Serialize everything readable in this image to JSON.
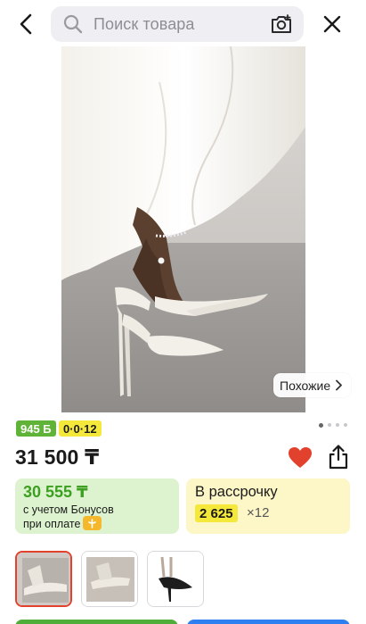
{
  "header": {
    "search_placeholder": "Поиск товара"
  },
  "gallery": {
    "similar_label": "Похожие",
    "pages": 4,
    "current_page": 1
  },
  "badges": {
    "rating": "945 Б",
    "installment": "0·0·12"
  },
  "product": {
    "price": "31 500 ₸",
    "favorite": true
  },
  "bonus": {
    "amount": "30 555 ₸",
    "line1": "с учетом Бонусов",
    "line2": "при оплате"
  },
  "installment": {
    "title": "В рассрочку",
    "amount": "2 625",
    "months": "×12"
  },
  "colors": {
    "accent_red": "#e2412e",
    "bonus_green": "#3ea022",
    "badge_yellow": "#f4e93b",
    "installment_bg": "#fdf6c7",
    "bonus_bg": "#ddf3cf"
  },
  "icons": [
    "back-icon",
    "search-icon",
    "camera-icon",
    "close-icon",
    "chevron-right-icon",
    "heart-icon",
    "share-icon",
    "bonus-icon"
  ]
}
